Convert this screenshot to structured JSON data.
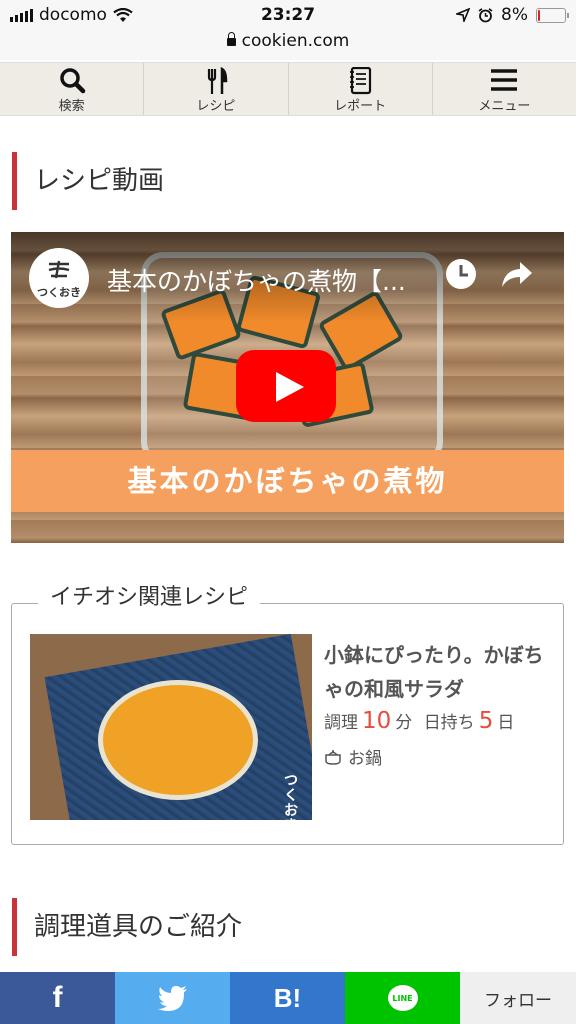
{
  "status": {
    "carrier": "docomo",
    "time": "23:27",
    "battery": "8%",
    "battery_level": 0.08
  },
  "url": {
    "domain": "cookien.com"
  },
  "nav": [
    {
      "label": "検索",
      "icon": "search-icon"
    },
    {
      "label": "レシピ",
      "icon": "fork-knife-icon"
    },
    {
      "label": "レポート",
      "icon": "notebook-icon"
    },
    {
      "label": "メニュー",
      "icon": "hamburger-menu-icon"
    }
  ],
  "sections": {
    "video": "レシピ動画",
    "tools": "調理道具のご紹介"
  },
  "video": {
    "title": "基本のかぼちゃの煮物【...",
    "channel_logo_text": "つくおき",
    "banner": "基本のかぼちゃの煮物"
  },
  "recommend": {
    "label": "イチオシ関連レシピ",
    "title": "小鉢にぴったり。かぼちゃの和風サラダ",
    "prep_label": "調理",
    "prep_value": "10",
    "prep_unit": "分",
    "keep_label": "日持ち",
    "keep_value": "5",
    "keep_unit": "日",
    "method": "お鍋",
    "thumb_badge": "つく\nおき"
  },
  "footer": {
    "facebook": "f",
    "hatena": "B!",
    "line": "LINE",
    "follow": "フォロー",
    "colors": {
      "facebook": "#3b5998",
      "twitter": "#55acee",
      "hatena": "#3377cc",
      "line": "#00c300"
    }
  }
}
